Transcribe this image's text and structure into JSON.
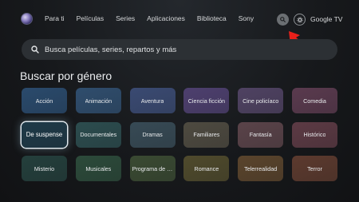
{
  "nav": {
    "items": [
      "Para ti",
      "Películas",
      "Series",
      "Aplicaciones",
      "Biblioteca",
      "Sony"
    ],
    "brand": "Google TV"
  },
  "search": {
    "placeholder": "Busca películas, series, repartos y más"
  },
  "section": {
    "title": "Buscar por género"
  },
  "genres": [
    {
      "label": "Acción",
      "color": "#2a4a6c"
    },
    {
      "label": "Animación",
      "color": "#2f4d6d"
    },
    {
      "label": "Aventura",
      "color": "#3a4a72"
    },
    {
      "label": "Ciencia ficción",
      "color": "#4d3f6e"
    },
    {
      "label": "Cine policíaco",
      "color": "#4f4262"
    },
    {
      "label": "Comedia",
      "color": "#5a3a4e"
    },
    {
      "label": "De suspense",
      "color": "#1f3a48",
      "focused": true
    },
    {
      "label": "Documentales",
      "color": "#2c4c4e"
    },
    {
      "label": "Dramas",
      "color": "#374a55"
    },
    {
      "label": "Familiares",
      "color": "#4e4a40"
    },
    {
      "label": "Fantasía",
      "color": "#5a4349"
    },
    {
      "label": "Histórico",
      "color": "#5c3a44"
    },
    {
      "label": "Misterio",
      "color": "#243f3c"
    },
    {
      "label": "Musicales",
      "color": "#2c4a3a"
    },
    {
      "label": "Programa de co...",
      "color": "#3a4a32"
    },
    {
      "label": "Romance",
      "color": "#4f4a2c"
    },
    {
      "label": "Telerrealidad",
      "color": "#5a442c"
    },
    {
      "label": "Terror",
      "color": "#5c3a2e"
    }
  ],
  "icons": {
    "search": "search-icon",
    "settings": "gear-icon",
    "annotation": "arrow-icon"
  },
  "colors": {
    "annotation_arrow": "#e8201a",
    "focus_ring": "#dfe7ec"
  }
}
